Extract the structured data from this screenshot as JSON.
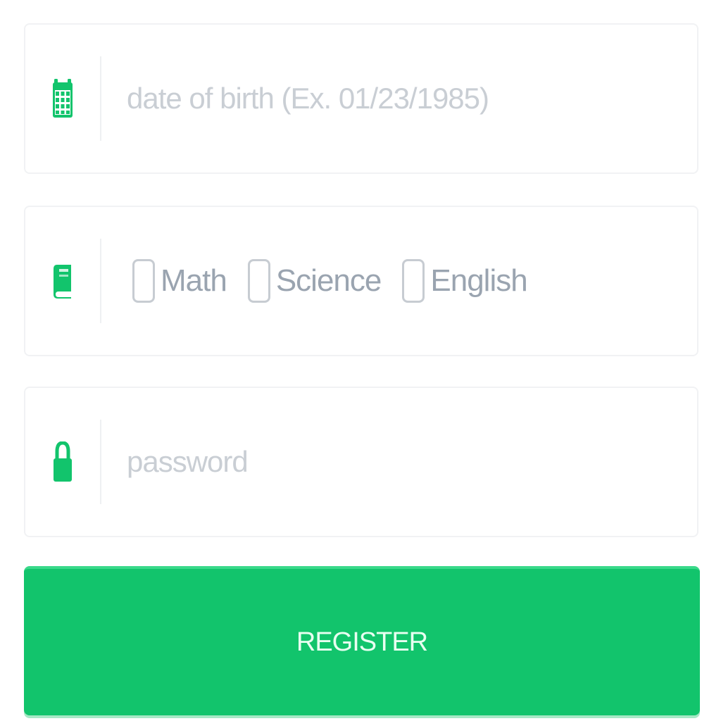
{
  "colors": {
    "accent": "#12c46c",
    "field_border": "#f1f2f4",
    "placeholder": "#c9ced4",
    "label": "#9aa4b0"
  },
  "dob": {
    "icon": "calendar-icon",
    "placeholder": "date of birth (Ex. 01/23/1985)",
    "value": ""
  },
  "subjects": {
    "icon": "book-icon",
    "options": [
      {
        "label": "Math",
        "checked": false
      },
      {
        "label": "Science",
        "checked": false
      },
      {
        "label": "English",
        "checked": false
      }
    ]
  },
  "password": {
    "icon": "lock-icon",
    "placeholder": "password",
    "value": ""
  },
  "register_button": {
    "label": "REGISTER"
  }
}
